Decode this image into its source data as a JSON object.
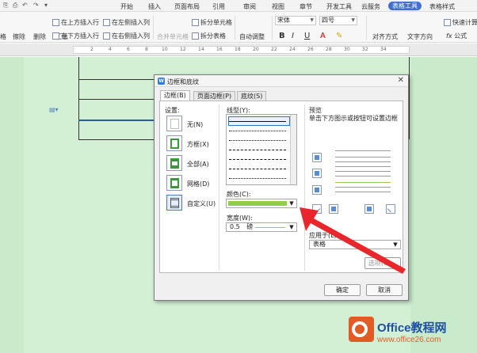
{
  "tabs": [
    "开始",
    "插入",
    "页面布局",
    "引用",
    "审阅",
    "视图",
    "章节",
    "开发工具",
    "云服务",
    "表格工具",
    "表格样式"
  ],
  "active_tab": "表格工具",
  "ribbon": {
    "draw_table": "格",
    "erase": "擦除",
    "delete": "删除",
    "summary": "汇总",
    "insert_above": "在上方插入行",
    "insert_below": "在下方插入行",
    "insert_left": "在左侧插入列",
    "insert_right": "在右侧插入列",
    "merge_cells": "合并单元格",
    "split_cells": "拆分单元格",
    "split_table": "拆分表格",
    "auto_fit": "自动调整",
    "font_name": "宋体",
    "font_size": "四号",
    "bold": "B",
    "italic": "I",
    "underline": "U",
    "font_color": "A",
    "align": "对齐方式",
    "text_direction": "文字方向",
    "quick_calc": "快速计算",
    "formula": "公式"
  },
  "ruler_numbers": [
    "2",
    "4",
    "6",
    "8",
    "10",
    "12",
    "14",
    "16",
    "18",
    "20",
    "22",
    "24",
    "26",
    "28",
    "30",
    "32",
    "34"
  ],
  "dialog": {
    "title": "边框和底纹",
    "tabs": [
      "边框(B)",
      "页面边框(P)",
      "底纹(S)"
    ],
    "active_tab": "边框(B)",
    "settings_label": "设置:",
    "settings": [
      "无(N)",
      "方框(X)",
      "全部(A)",
      "网格(D)",
      "自定义(U)"
    ],
    "selected_setting": "自定义(U)",
    "line_style_label": "线型(Y):",
    "color_label": "颜色(C):",
    "color_value": "#8fce4a",
    "width_label": "宽度(W):",
    "width_value": "0.5",
    "width_unit": "磅",
    "preview_label": "预览",
    "preview_hint": "单击下方图示或按钮可设置边框",
    "apply_to_label": "应用于(L):",
    "apply_to_value": "表格",
    "options_button": "选项(O)...",
    "ok_button": "确定",
    "cancel_button": "取消"
  },
  "watermark": {
    "name": "Office教程网",
    "url": "www.office26.com"
  }
}
